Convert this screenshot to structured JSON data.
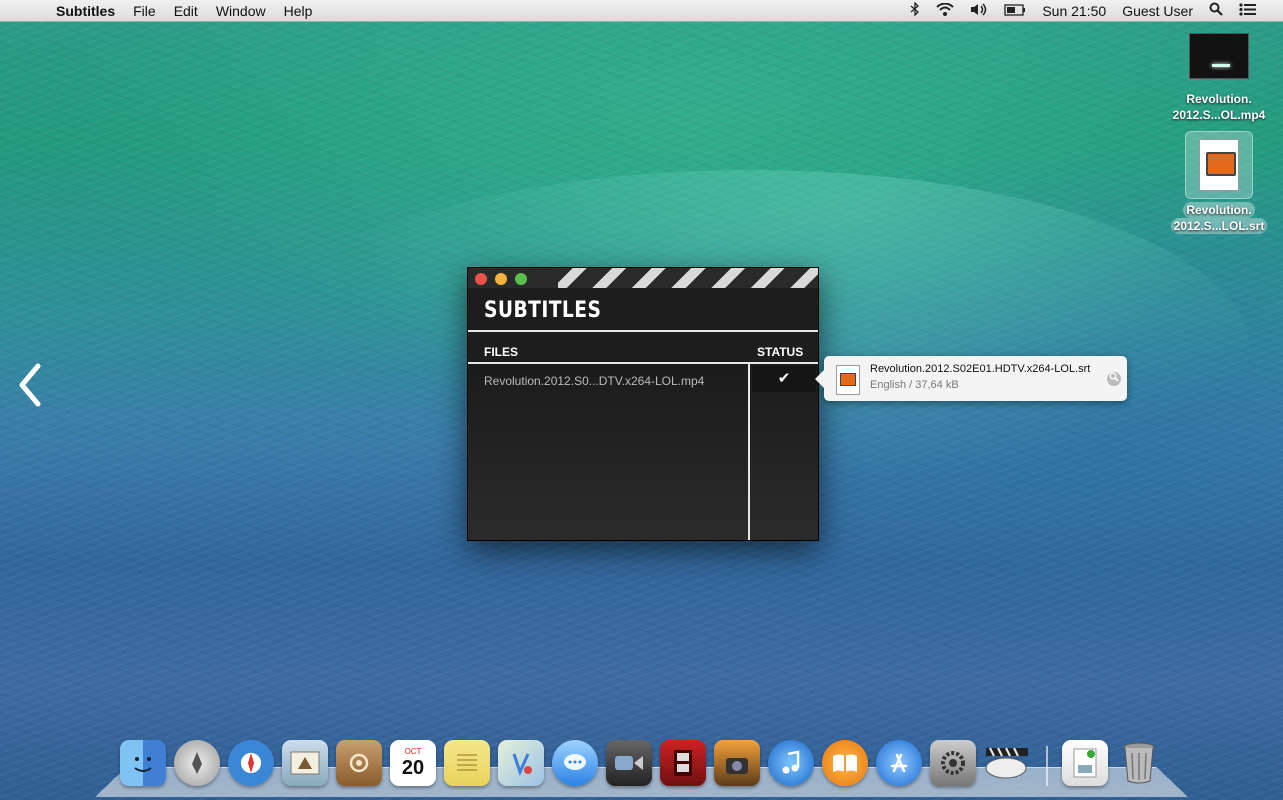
{
  "menubar": {
    "app_name": "Subtitles",
    "menus": [
      "File",
      "Edit",
      "Window",
      "Help"
    ],
    "clock": "Sun 21:50",
    "user": "Guest User"
  },
  "desktop": {
    "icons": [
      {
        "line1": "Revolution.",
        "line2": "2012.S...OL.mp4"
      },
      {
        "line1": "Revolution.",
        "line2": "2012.S...LOL.srt"
      }
    ]
  },
  "window": {
    "title": "SUBTITLES",
    "col_files": "FILES",
    "col_status": "STATUS",
    "rows": [
      {
        "file": "Revolution.2012.S0...DTV.x264-LOL.mp4",
        "status": "✔"
      }
    ]
  },
  "popover": {
    "filename": "Revolution.2012.S02E01.HDTV.x264-LOL.srt",
    "meta": "English / 37,64 kB"
  },
  "dock": {
    "items": [
      "finder-icon",
      "launchpad-icon",
      "safari-icon",
      "mail-icon",
      "contacts-icon",
      "calendar-icon",
      "notes-icon",
      "maps-icon",
      "messages-icon",
      "facetime-icon",
      "photo-booth-icon",
      "iphoto-icon",
      "itunes-icon",
      "ibooks-icon",
      "app-store-icon",
      "system-preferences-icon",
      "subtitles-app-icon",
      "documents-folder-icon",
      "trash-icon"
    ],
    "calendar_month": "OCT",
    "calendar_day": "20"
  }
}
